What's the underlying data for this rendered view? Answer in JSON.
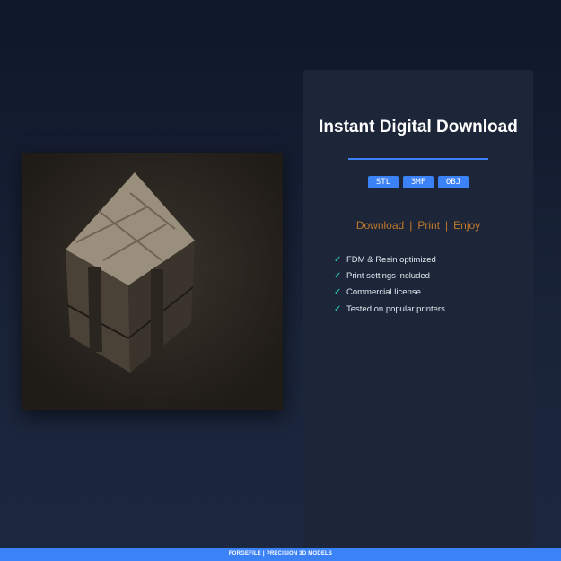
{
  "product": {
    "image_alt": "Textured 2x2 cube 3D model"
  },
  "panel": {
    "title": "Instant Digital Download",
    "formats": [
      "STL",
      "3MF",
      "OBJ"
    ],
    "tagline": {
      "parts": [
        "Download",
        "Print",
        "Enjoy"
      ],
      "separator": "|"
    },
    "features": [
      "FDM & Resin optimized",
      "Print settings included",
      "Commercial license",
      "Tested on popular printers"
    ]
  },
  "footer": {
    "text": "FORGEFILE | PRECISION 3D MODELS"
  },
  "colors": {
    "accent": "#3b82f6",
    "tagline": "#c2782a",
    "check": "#2dd4bf"
  }
}
